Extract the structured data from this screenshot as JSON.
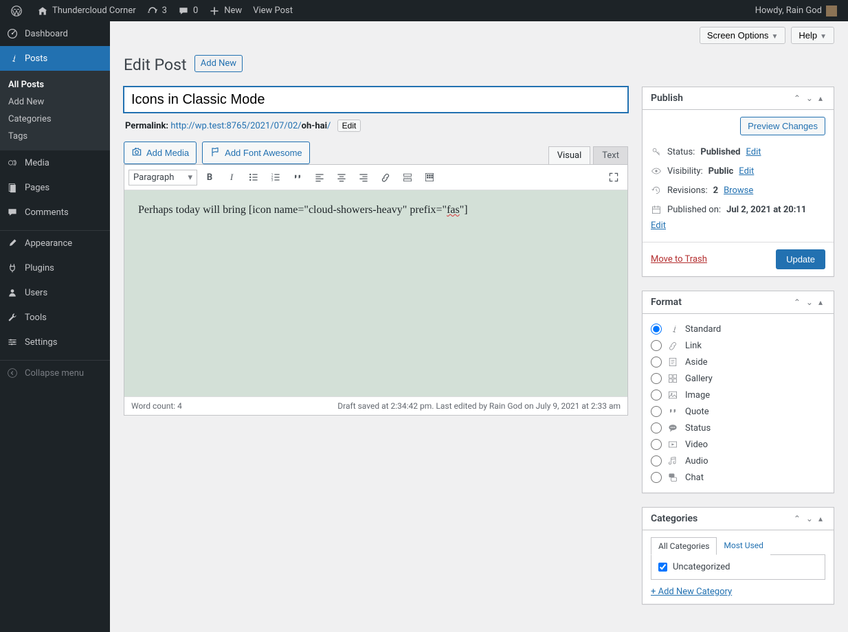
{
  "adminBar": {
    "siteName": "Thundercloud Corner",
    "updateCount": "3",
    "commentCount": "0",
    "newLabel": "New",
    "viewPost": "View Post",
    "howdy": "Howdy, Rain God"
  },
  "sidebar": {
    "dashboard": "Dashboard",
    "posts": "Posts",
    "media": "Media",
    "pages": "Pages",
    "comments": "Comments",
    "appearance": "Appearance",
    "plugins": "Plugins",
    "users": "Users",
    "tools": "Tools",
    "settings": "Settings",
    "collapse": "Collapse menu",
    "submenu": {
      "allPosts": "All Posts",
      "addNew": "Add New",
      "categories": "Categories",
      "tags": "Tags"
    }
  },
  "topActions": {
    "screenOptions": "Screen Options",
    "help": "Help"
  },
  "pageTitle": "Edit Post",
  "addNew": "Add New",
  "post": {
    "title": "Icons in Classic Mode",
    "permalinkLabel": "Permalink:",
    "permalinkBase": "http://wp.test:8765/2021/07/02/",
    "permalinkSlug": "oh-hai",
    "permalinkSlash": "/",
    "editBtn": "Edit",
    "addMedia": "Add Media",
    "addFontAwesome": "Add Font Awesome",
    "tabVisual": "Visual",
    "tabText": "Text",
    "paragraph": "Paragraph",
    "bodyPrefix": "Perhaps today will bring [icon name=\"cloud-showers-heavy\" prefix=\"",
    "bodyMid": "fas",
    "bodySuffix": "\"]",
    "wordCount": "Word count: 4",
    "draftStatus": "Draft saved at 2:34:42 pm. Last edited by Rain God on July 9, 2021 at 2:33 am"
  },
  "publish": {
    "title": "Publish",
    "previewChanges": "Preview Changes",
    "statusLabel": "Status:",
    "statusValue": "Published",
    "visibilityLabel": "Visibility:",
    "visibilityValue": "Public",
    "revisionsLabel": "Revisions:",
    "revisionsCount": "2",
    "browse": "Browse",
    "publishedOnLabel": "Published on:",
    "publishedOnValue": "Jul 2, 2021 at 20:11",
    "edit": "Edit",
    "trash": "Move to Trash",
    "update": "Update"
  },
  "format": {
    "title": "Format",
    "options": [
      "Standard",
      "Link",
      "Aside",
      "Gallery",
      "Image",
      "Quote",
      "Status",
      "Video",
      "Audio",
      "Chat"
    ]
  },
  "categories": {
    "title": "Categories",
    "allCategories": "All Categories",
    "mostUsed": "Most Used",
    "uncat": "Uncategorized",
    "addNew": "+ Add New Category"
  }
}
